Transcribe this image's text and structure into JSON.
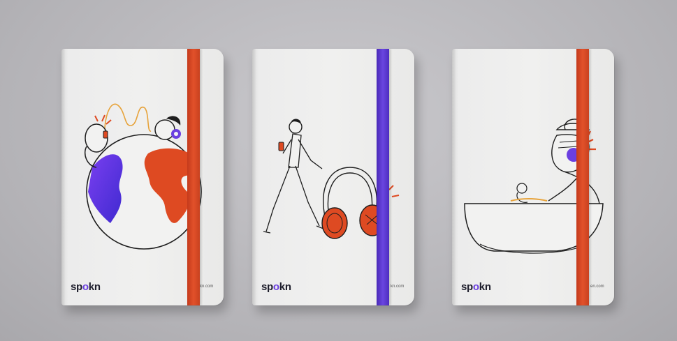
{
  "scene": {
    "background_color": "#b9b8bc",
    "notebooks": [
      {
        "brand_before": "sp",
        "brand_mid": "o",
        "brand_after": "kn",
        "url": "kn.com",
        "band_color": "#d9481f",
        "illustration": "globe-with-people-icon"
      },
      {
        "brand_before": "sp",
        "brand_mid": "o",
        "brand_after": "kn",
        "url": "kn.com",
        "band_color": "#5a38d6",
        "illustration": "man-with-headphones-icon"
      },
      {
        "brand_before": "sp",
        "brand_mid": "o",
        "brand_after": "kn",
        "url": "en.com",
        "band_color": "#d9481f",
        "illustration": "person-with-bowl-icon"
      }
    ]
  }
}
